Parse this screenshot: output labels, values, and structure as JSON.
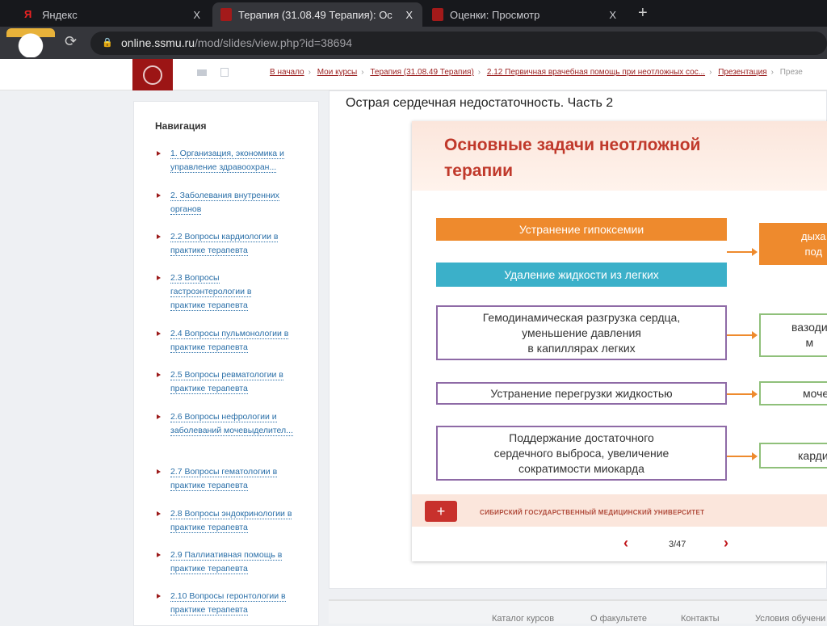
{
  "browser": {
    "tabs": [
      {
        "label": "Яндекс",
        "close": "X"
      },
      {
        "label": "Терапия (31.08.49 Терапия): Ос",
        "close": "X"
      },
      {
        "label": "Оценки: Просмотр",
        "close": "X"
      }
    ],
    "new_tab": "+",
    "url_host": "online.ssmu.ru",
    "url_path": "/mod/slides/view.php?id=38694"
  },
  "breadcrumbs": [
    "В начало",
    "Мои курсы",
    "Терапия (31.08.49 Терапия)",
    "2.12 Первичная врачебная помощь при неотложных сос...",
    "Презентация",
    "Презе"
  ],
  "sidebar": {
    "title": "Навигация",
    "items": [
      "1. Организация, экономика и управление здравоохран...",
      "2. Заболевания внутренних органов",
      "2.2 Вопросы кардиологии в практике терапевта",
      "2.3 Вопросы гастроэнтерологии в практике терапевта",
      "2.4 Вопросы пульмонологии в практике терапевта",
      "2.5 Вопросы ревматологии в практике терапевта",
      "2.6 Вопросы нефрологии и заболеваний мочевыделител...",
      "2.7 Вопросы гематологии в практике терапевта",
      "2.8 Вопросы эндокринологии в практике терапевта",
      "2.9 Паллиативная помощь в практике терапевта",
      "2.10 Вопросы геронтологии в практике терапевта"
    ]
  },
  "main": {
    "title": "Острая сердечная недостаточность. Часть 2",
    "slide": {
      "heading_1": "Основные задачи неотложной",
      "heading_2": "терапии",
      "tasks": [
        "Устранение гипоксемии",
        "Удаление жидкости из легких",
        "Гемодинамическая разгрузка сердца,\nуменьшение давления\nв капиллярах легких",
        "Устранение перегрузки жидкостью",
        "Поддержание достаточного\nсердечного выброса, увеличение\nсократимости миокарда"
      ],
      "results": [
        "дыха\nпод",
        "вазоди\nм",
        "моче",
        "карди"
      ],
      "university": "СИБИРСКИЙ ГОСУДАРСТВЕННЫЙ МЕДИЦИНСКИЙ УНИВЕРСИТЕТ"
    },
    "pager": {
      "prev": "‹",
      "next": "›",
      "page": "3/47"
    }
  },
  "footer": [
    "Каталог курсов",
    "О факультете",
    "Контакты",
    "Условия обучени"
  ]
}
